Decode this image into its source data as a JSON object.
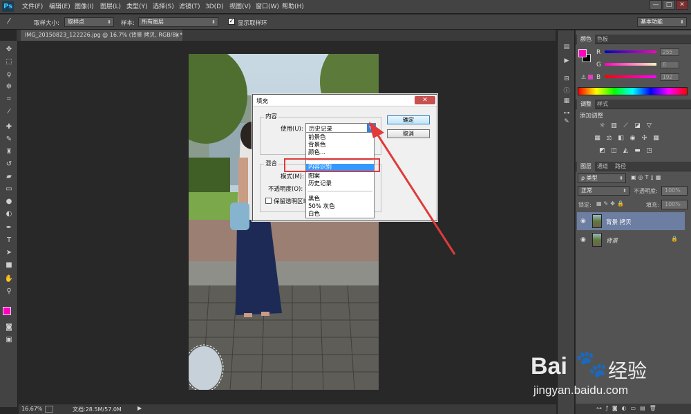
{
  "menubar": {
    "logo": "Ps",
    "items": [
      "文件(F)",
      "编辑(E)",
      "图像(I)",
      "图层(L)",
      "类型(Y)",
      "选择(S)",
      "滤镜(T)",
      "3D(D)",
      "视图(V)",
      "窗口(W)",
      "帮助(H)"
    ],
    "window_buttons": [
      "—",
      "□",
      "✕"
    ]
  },
  "optionsbar": {
    "sample_size_label": "取样大小:",
    "sample_size_value": "取样点",
    "sample_label": "样本:",
    "sample_value": "所有图层",
    "show_ring_label": "显示取样环",
    "workspace": "基本功能"
  },
  "document": {
    "tab_title": "IMG_20150823_122226.jpg @ 16.7% (背景 拷贝, RGB/8) *",
    "tab_close": "×"
  },
  "statusbar": {
    "zoom": "16.67%",
    "doc_info": "文档:28.5M/57.0M"
  },
  "color_panel": {
    "tabs": [
      "颜色",
      "色板"
    ],
    "r_label": "R",
    "g_label": "G",
    "b_label": "B",
    "r_value": "255",
    "g_value": "0",
    "b_value": "192",
    "foreground": "#ff00c0"
  },
  "adjust_panel": {
    "tabs": [
      "调整",
      "样式"
    ],
    "title": "添加调整"
  },
  "layers_panel": {
    "tabs": [
      "图层",
      "通道",
      "路径"
    ],
    "filter_kind": "ρ 类型",
    "blend_mode": "正常",
    "opacity_label": "不透明度:",
    "opacity_value": "100%",
    "lock_label": "锁定:",
    "fill_label": "填充:",
    "fill_value": "100%",
    "layers": [
      {
        "name": "背景 拷贝",
        "selected": true
      },
      {
        "name": "背景",
        "selected": false,
        "italic": true
      }
    ]
  },
  "dialog": {
    "title": "填充",
    "content_group": "内容",
    "use_label": "使用(U):",
    "use_value": "历史记录",
    "blend_group": "混合",
    "mode_label": "模式(M):",
    "opacity_label": "不透明度(O):",
    "preserve_label": "保留透明区域",
    "ok": "确定",
    "cancel": "取消",
    "dropdown_items": [
      "前景色",
      "背景色",
      "颜色...",
      "内容识别",
      "图案",
      "历史记录",
      "黑色",
      "50% 灰色",
      "白色"
    ],
    "selected_item": "内容识别"
  },
  "watermark": {
    "brand_left": "Bai",
    "brand_right": "经验",
    "url": "jingyan.baidu.com"
  }
}
